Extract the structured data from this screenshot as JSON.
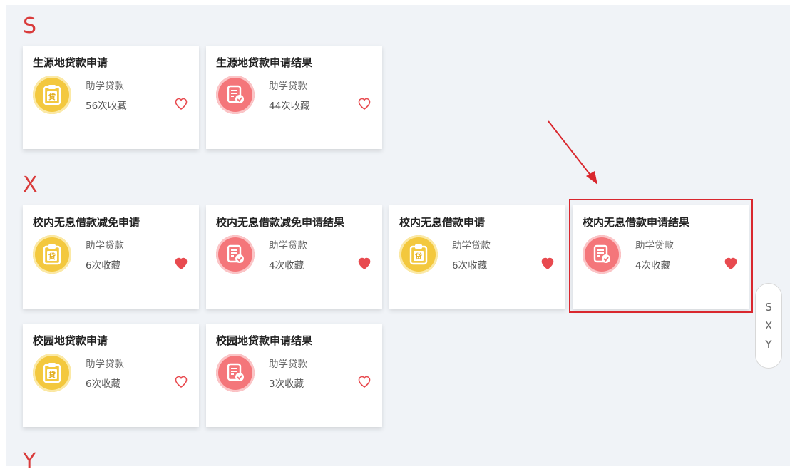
{
  "sections": [
    {
      "letter": "S"
    },
    {
      "letter": "X"
    },
    {
      "letter": "Y"
    }
  ],
  "cards": [
    {
      "title": "生源地贷款申请",
      "category": "助学贷款",
      "count": "56次收藏",
      "icon": "loan-clipboard-icon",
      "icon_color": "yellow",
      "favorited": false
    },
    {
      "title": "生源地贷款申请结果",
      "category": "助学贷款",
      "count": "44次收藏",
      "icon": "result-document-icon",
      "icon_color": "red",
      "favorited": false
    },
    {
      "title": "校内无息借款减免申请",
      "category": "助学贷款",
      "count": "6次收藏",
      "icon": "loan-clipboard-icon",
      "icon_color": "yellow",
      "favorited": true
    },
    {
      "title": "校内无息借款减免申请结果",
      "category": "助学贷款",
      "count": "4次收藏",
      "icon": "result-document-icon",
      "icon_color": "red",
      "favorited": true
    },
    {
      "title": "校内无息借款申请",
      "category": "助学贷款",
      "count": "6次收藏",
      "icon": "loan-clipboard-icon",
      "icon_color": "yellow",
      "favorited": true
    },
    {
      "title": "校内无息借款申请结果",
      "category": "助学贷款",
      "count": "4次收藏",
      "icon": "result-document-icon",
      "icon_color": "red",
      "favorited": true
    },
    {
      "title": "校园地贷款申请",
      "category": "助学贷款",
      "count": "6次收藏",
      "icon": "loan-clipboard-icon",
      "icon_color": "yellow",
      "favorited": false
    },
    {
      "title": "校园地贷款申请结果",
      "category": "助学贷款",
      "count": "3次收藏",
      "icon": "result-document-icon",
      "icon_color": "red",
      "favorited": false
    }
  ],
  "loan_badge_char": "贷",
  "index_nav": [
    "S",
    "X",
    "Y"
  ],
  "colors": {
    "accent": "#d93b3b",
    "heart": "#e84a4f",
    "yellow": "#f3c83e",
    "red": "#f4767a",
    "annotation": "#d9272e"
  }
}
